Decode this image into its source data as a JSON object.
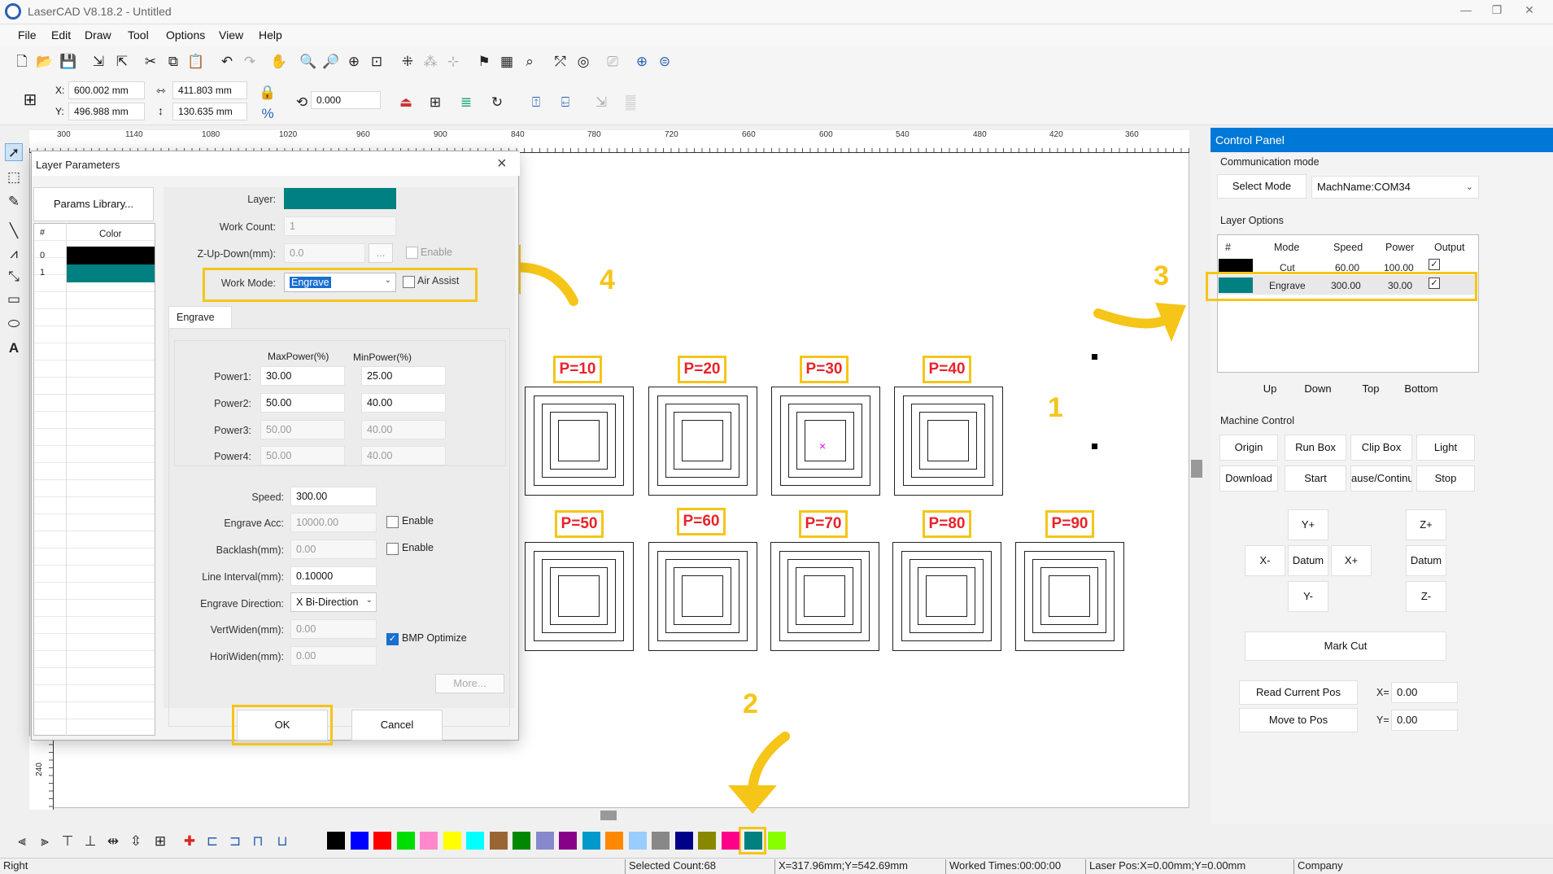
{
  "app": {
    "title": "LaserCAD V8.18.2 - Untitled"
  },
  "menu": [
    "File",
    "Edit",
    "Draw",
    "Tool",
    "Options",
    "View",
    "Help"
  ],
  "coords": {
    "x_label": "X:",
    "x": "600.002 mm",
    "y_label": "Y:",
    "y": "496.988 mm",
    "w": "411.803 mm",
    "h": "130.635 mm",
    "rotate": "0.000"
  },
  "ruler": [
    "300",
    "1140",
    "1080",
    "1020",
    "960",
    "900",
    "840",
    "780",
    "720",
    "660",
    "600",
    "540",
    "480",
    "420",
    "360"
  ],
  "vruler": "240",
  "canvas": {
    "row1": [
      "P=10",
      "P=20",
      "P=30",
      "P=40"
    ],
    "row2": [
      "P=50",
      "P=60",
      "P=70",
      "P=80",
      "P=90"
    ],
    "steps": [
      "1",
      "2",
      "3",
      "4"
    ]
  },
  "dialog": {
    "title": "Layer Parameters",
    "close": "×",
    "params_library": "Params Library...",
    "table_headers": [
      "#",
      "Color"
    ],
    "rows": [
      {
        "num": "0",
        "color": "#000000"
      },
      {
        "num": "1",
        "color": "#008080"
      }
    ],
    "layer_label": "Layer:",
    "layer_color": "#008080",
    "work_count_label": "Work Count:",
    "work_count": "1",
    "zupdown_label": "Z-Up-Down(mm):",
    "zupdown": "0.0",
    "ellipsis": "...",
    "enable": "Enable",
    "work_mode_label": "Work Mode:",
    "work_mode": "Engrave",
    "air_assist": "Air Assist",
    "engrave_tab": "Engrave",
    "maxpower_header": "MaxPower(%)",
    "minpower_header": "MinPower(%)",
    "powers": [
      {
        "label": "Power1:",
        "max": "30.00",
        "min": "25.00",
        "enabled": true
      },
      {
        "label": "Power2:",
        "max": "50.00",
        "min": "40.00",
        "enabled": true
      },
      {
        "label": "Power3:",
        "max": "50.00",
        "min": "40.00",
        "enabled": false
      },
      {
        "label": "Power4:",
        "max": "50.00",
        "min": "40.00",
        "enabled": false
      }
    ],
    "speed_label": "Speed:",
    "speed": "300.00",
    "engrave_acc_label": "Engrave Acc:",
    "engrave_acc": "10000.00",
    "backlash_label": "Backlash(mm):",
    "backlash": "0.00",
    "line_interval_label": "Line Interval(mm):",
    "line_interval": "0.10000",
    "engrave_dir_label": "Engrave Direction:",
    "engrave_dir": "X Bi-Direction",
    "vertwiden_label": "VertWiden(mm):",
    "vertwiden": "0.00",
    "horiwiden_label": "HoriWiden(mm):",
    "horiwiden": "0.00",
    "bmp_optimize": "BMP Optimize",
    "more": "More...",
    "ok": "OK",
    "cancel": "Cancel"
  },
  "control_panel": {
    "title": "Control Panel",
    "comm_mode": "Communication mode",
    "select_mode": "Select Mode",
    "mach_name": "MachName:COM34",
    "layer_options": "Layer Options",
    "headers": [
      "#",
      "Mode",
      "Speed",
      "Power",
      "Output"
    ],
    "layers": [
      {
        "color": "#000000",
        "mode": "Cut",
        "speed": "60.00",
        "power": "100.00",
        "output": true
      },
      {
        "color": "#008080",
        "mode": "Engrave",
        "speed": "300.00",
        "power": "30.00",
        "output": true
      }
    ],
    "order_buttons": [
      "Up",
      "Down",
      "Top",
      "Bottom"
    ],
    "machine_control": "Machine Control",
    "mc_row1": [
      "Origin",
      "Run Box",
      "Clip Box",
      "Light"
    ],
    "mc_row2": [
      "Download",
      "Start",
      "ause/Continu",
      "Stop"
    ],
    "jog": {
      "yplus": "Y+",
      "xminus": "X-",
      "datum": "Datum",
      "xplus": "X+",
      "yminus": "Y-",
      "zplus": "Z+",
      "zdatum": "Datum",
      "zminus": "Z-"
    },
    "mark_cut": "Mark Cut",
    "read_pos": "Read Current Pos",
    "move_pos": "Move to Pos",
    "x_label": "X=",
    "x_val": "0.00",
    "y_label": "Y=",
    "y_val": "0.00"
  },
  "palette": [
    "#000000",
    "#0000ff",
    "#ff0000",
    "#00dd00",
    "#ff88cc",
    "#ffff00",
    "#00ffff",
    "#996633",
    "#008800",
    "#8888cc",
    "#880088",
    "#0099cc",
    "#ff8800",
    "#99ccff",
    "#888888",
    "#000088",
    "#888800",
    "#ff0088",
    "#008080",
    "#88ff00"
  ],
  "status": {
    "left": "Right",
    "selected": "Selected Count:68",
    "cursor": "X=317.96mm;Y=542.69mm",
    "worked": "Worked Times:00:00:00",
    "laser": "Laser Pos:X=0.00mm;Y=0.00mm",
    "company": "Company"
  }
}
